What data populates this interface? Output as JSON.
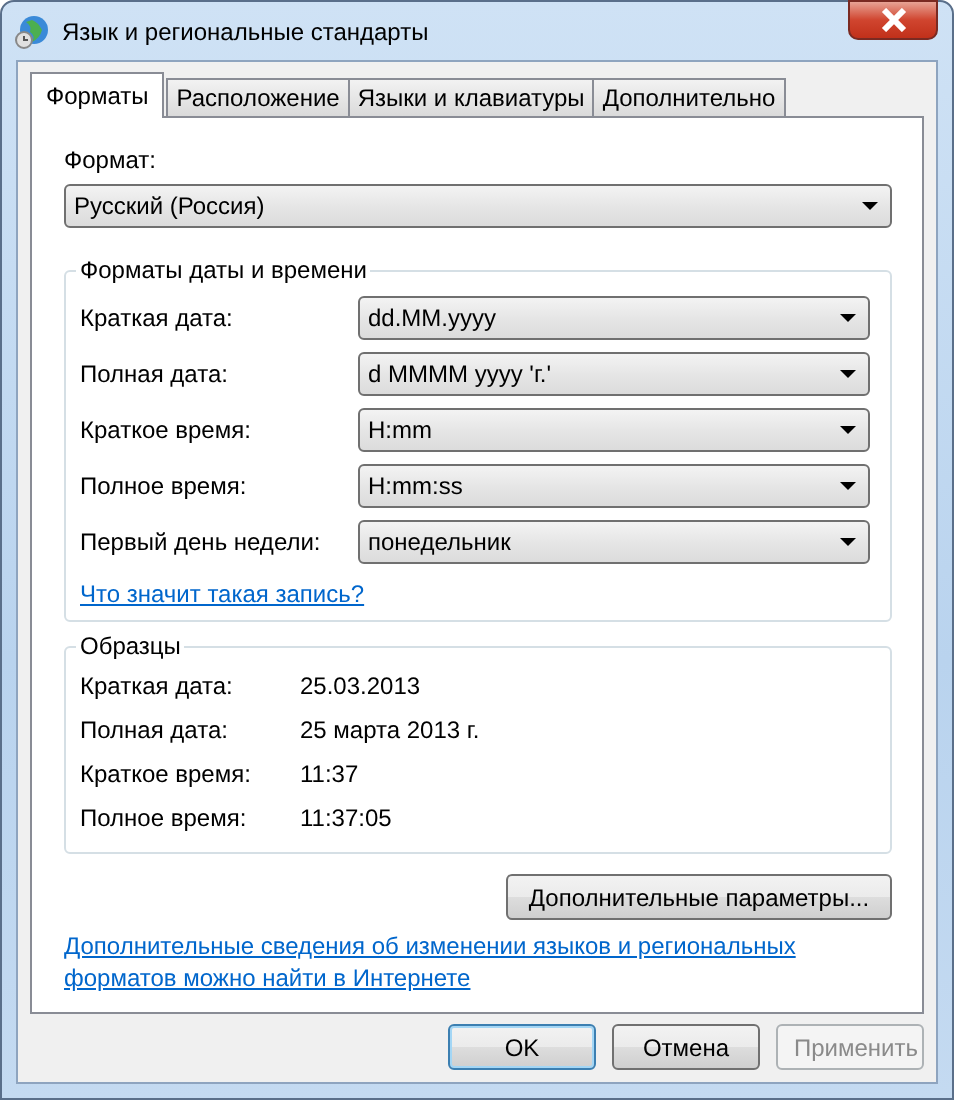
{
  "window": {
    "title": "Язык и региональные стандарты"
  },
  "tabs": [
    {
      "label": "Форматы",
      "selected": true
    },
    {
      "label": "Расположение",
      "selected": false
    },
    {
      "label": "Языки и клавиатуры",
      "selected": false
    },
    {
      "label": "Дополнительно",
      "selected": false
    }
  ],
  "format": {
    "label": "Формат:",
    "value": "Русский (Россия)"
  },
  "date_time_formats": {
    "title": "Форматы даты и времени",
    "rows": [
      {
        "label": "Краткая дата:",
        "value": "dd.MM.yyyy"
      },
      {
        "label": "Полная дата:",
        "value": "d MMMM yyyy 'г.'"
      },
      {
        "label": "Краткое время:",
        "value": "H:mm"
      },
      {
        "label": "Полное время:",
        "value": "H:mm:ss"
      },
      {
        "label": "Первый день недели:",
        "value": "понедельник"
      }
    ],
    "link": "Что значит такая запись?"
  },
  "samples": {
    "title": "Образцы",
    "rows": [
      {
        "label": "Краткая дата:",
        "value": "25.03.2013"
      },
      {
        "label": "Полная дата:",
        "value": "25 марта 2013 г."
      },
      {
        "label": "Краткое время:",
        "value": "11:37"
      },
      {
        "label": "Полное время:",
        "value": "11:37:05"
      }
    ]
  },
  "advanced_button": "Дополнительные параметры...",
  "info_link": "Дополнительные сведения об изменении языков и региональных форматов можно найти в Интернете",
  "buttons": [
    {
      "label": "OK",
      "default": true,
      "disabled": false
    },
    {
      "label": "Отмена",
      "default": false,
      "disabled": false
    },
    {
      "label": "Применить",
      "default": false,
      "disabled": true
    }
  ]
}
